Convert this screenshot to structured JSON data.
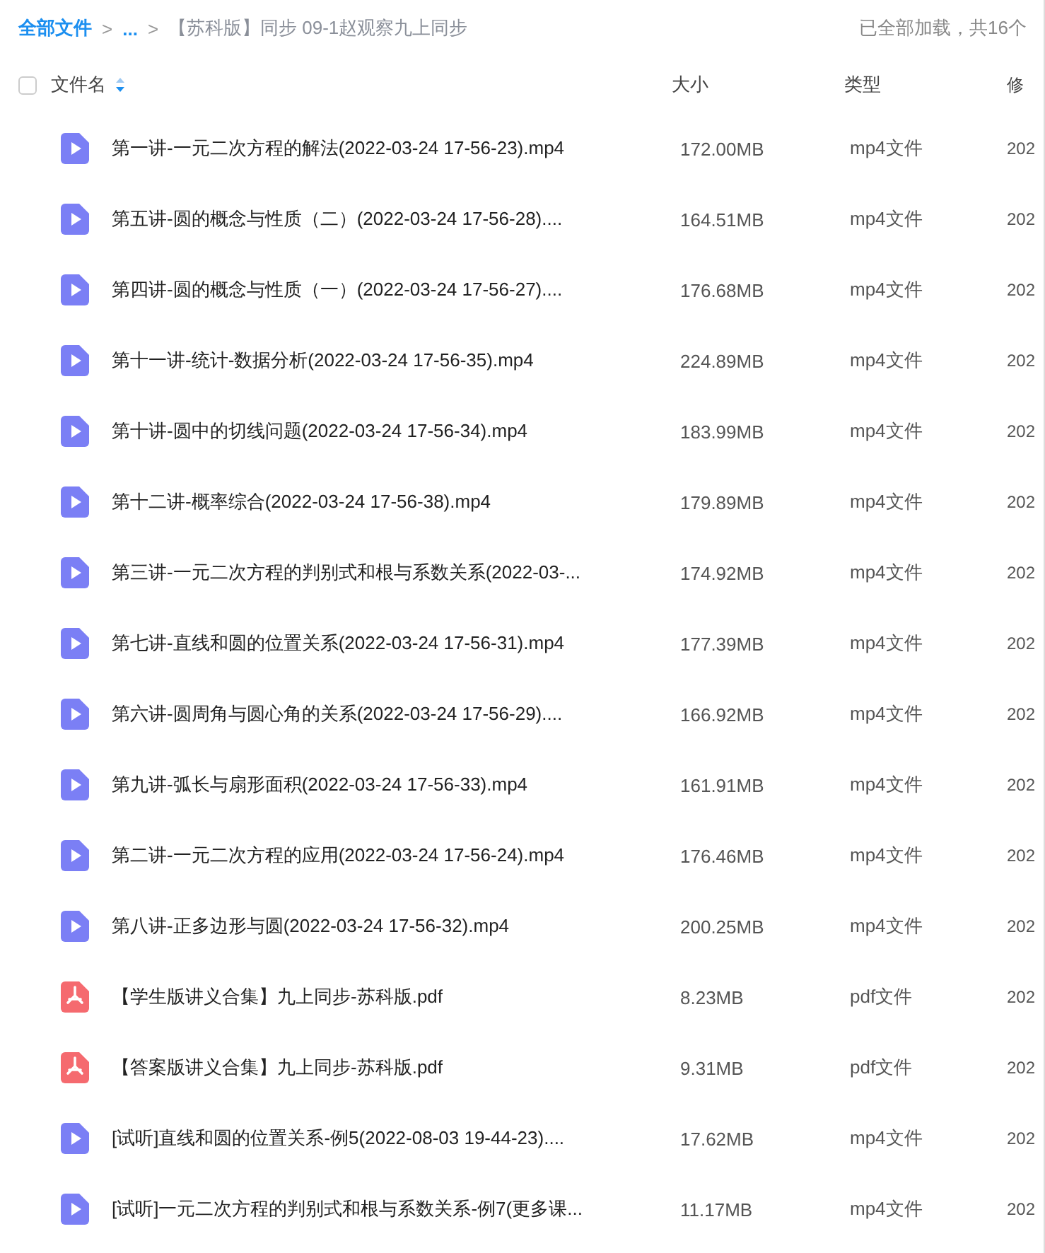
{
  "breadcrumb": {
    "root": "全部文件",
    "separator_1": ">",
    "ellipsis": "...",
    "separator_2": ">",
    "current": "【苏科版】同步 09-1赵观察九上同步"
  },
  "load_status": "已全部加载，共16个",
  "table": {
    "select_all": {
      "checked": false
    },
    "columns": [
      {
        "label": "文件名"
      },
      {
        "label": "大小"
      },
      {
        "label": "类型"
      },
      {
        "label": "修"
      }
    ],
    "rows": [
      {
        "kind": "video",
        "name": "第一讲-一元二次方程的解法(2022-03-24 17-56-23).mp4",
        "size": "172.00MB",
        "type": "mp4文件",
        "modified": "202"
      },
      {
        "kind": "video",
        "name": "第五讲-圆的概念与性质（二）(2022-03-24 17-56-28)....",
        "size": "164.51MB",
        "type": "mp4文件",
        "modified": "202"
      },
      {
        "kind": "video",
        "name": "第四讲-圆的概念与性质（一）(2022-03-24 17-56-27)....",
        "size": "176.68MB",
        "type": "mp4文件",
        "modified": "202"
      },
      {
        "kind": "video",
        "name": "第十一讲-统计-数据分析(2022-03-24 17-56-35).mp4",
        "size": "224.89MB",
        "type": "mp4文件",
        "modified": "202"
      },
      {
        "kind": "video",
        "name": "第十讲-圆中的切线问题(2022-03-24 17-56-34).mp4",
        "size": "183.99MB",
        "type": "mp4文件",
        "modified": "202"
      },
      {
        "kind": "video",
        "name": "第十二讲-概率综合(2022-03-24 17-56-38).mp4",
        "size": "179.89MB",
        "type": "mp4文件",
        "modified": "202"
      },
      {
        "kind": "video",
        "name": "第三讲-一元二次方程的判别式和根与系数关系(2022-03-...",
        "size": "174.92MB",
        "type": "mp4文件",
        "modified": "202"
      },
      {
        "kind": "video",
        "name": "第七讲-直线和圆的位置关系(2022-03-24 17-56-31).mp4",
        "size": "177.39MB",
        "type": "mp4文件",
        "modified": "202"
      },
      {
        "kind": "video",
        "name": "第六讲-圆周角与圆心角的关系(2022-03-24 17-56-29)....",
        "size": "166.92MB",
        "type": "mp4文件",
        "modified": "202"
      },
      {
        "kind": "video",
        "name": "第九讲-弧长与扇形面积(2022-03-24 17-56-33).mp4",
        "size": "161.91MB",
        "type": "mp4文件",
        "modified": "202"
      },
      {
        "kind": "video",
        "name": "第二讲-一元二次方程的应用(2022-03-24 17-56-24).mp4",
        "size": "176.46MB",
        "type": "mp4文件",
        "modified": "202"
      },
      {
        "kind": "video",
        "name": "第八讲-正多边形与圆(2022-03-24 17-56-32).mp4",
        "size": "200.25MB",
        "type": "mp4文件",
        "modified": "202"
      },
      {
        "kind": "pdf",
        "name": "【学生版讲义合集】九上同步-苏科版.pdf",
        "size": "8.23MB",
        "type": "pdf文件",
        "modified": "202"
      },
      {
        "kind": "pdf",
        "name": "【答案版讲义合集】九上同步-苏科版.pdf",
        "size": "9.31MB",
        "type": "pdf文件",
        "modified": "202"
      },
      {
        "kind": "video",
        "name": "[试听]直线和圆的位置关系-例5(2022-08-03 19-44-23)....",
        "size": "17.62MB",
        "type": "mp4文件",
        "modified": "202"
      },
      {
        "kind": "video",
        "name": "[试听]一元二次方程的判别式和根与系数关系-例7(更多课...",
        "size": "11.17MB",
        "type": "mp4文件",
        "modified": "202"
      }
    ]
  }
}
